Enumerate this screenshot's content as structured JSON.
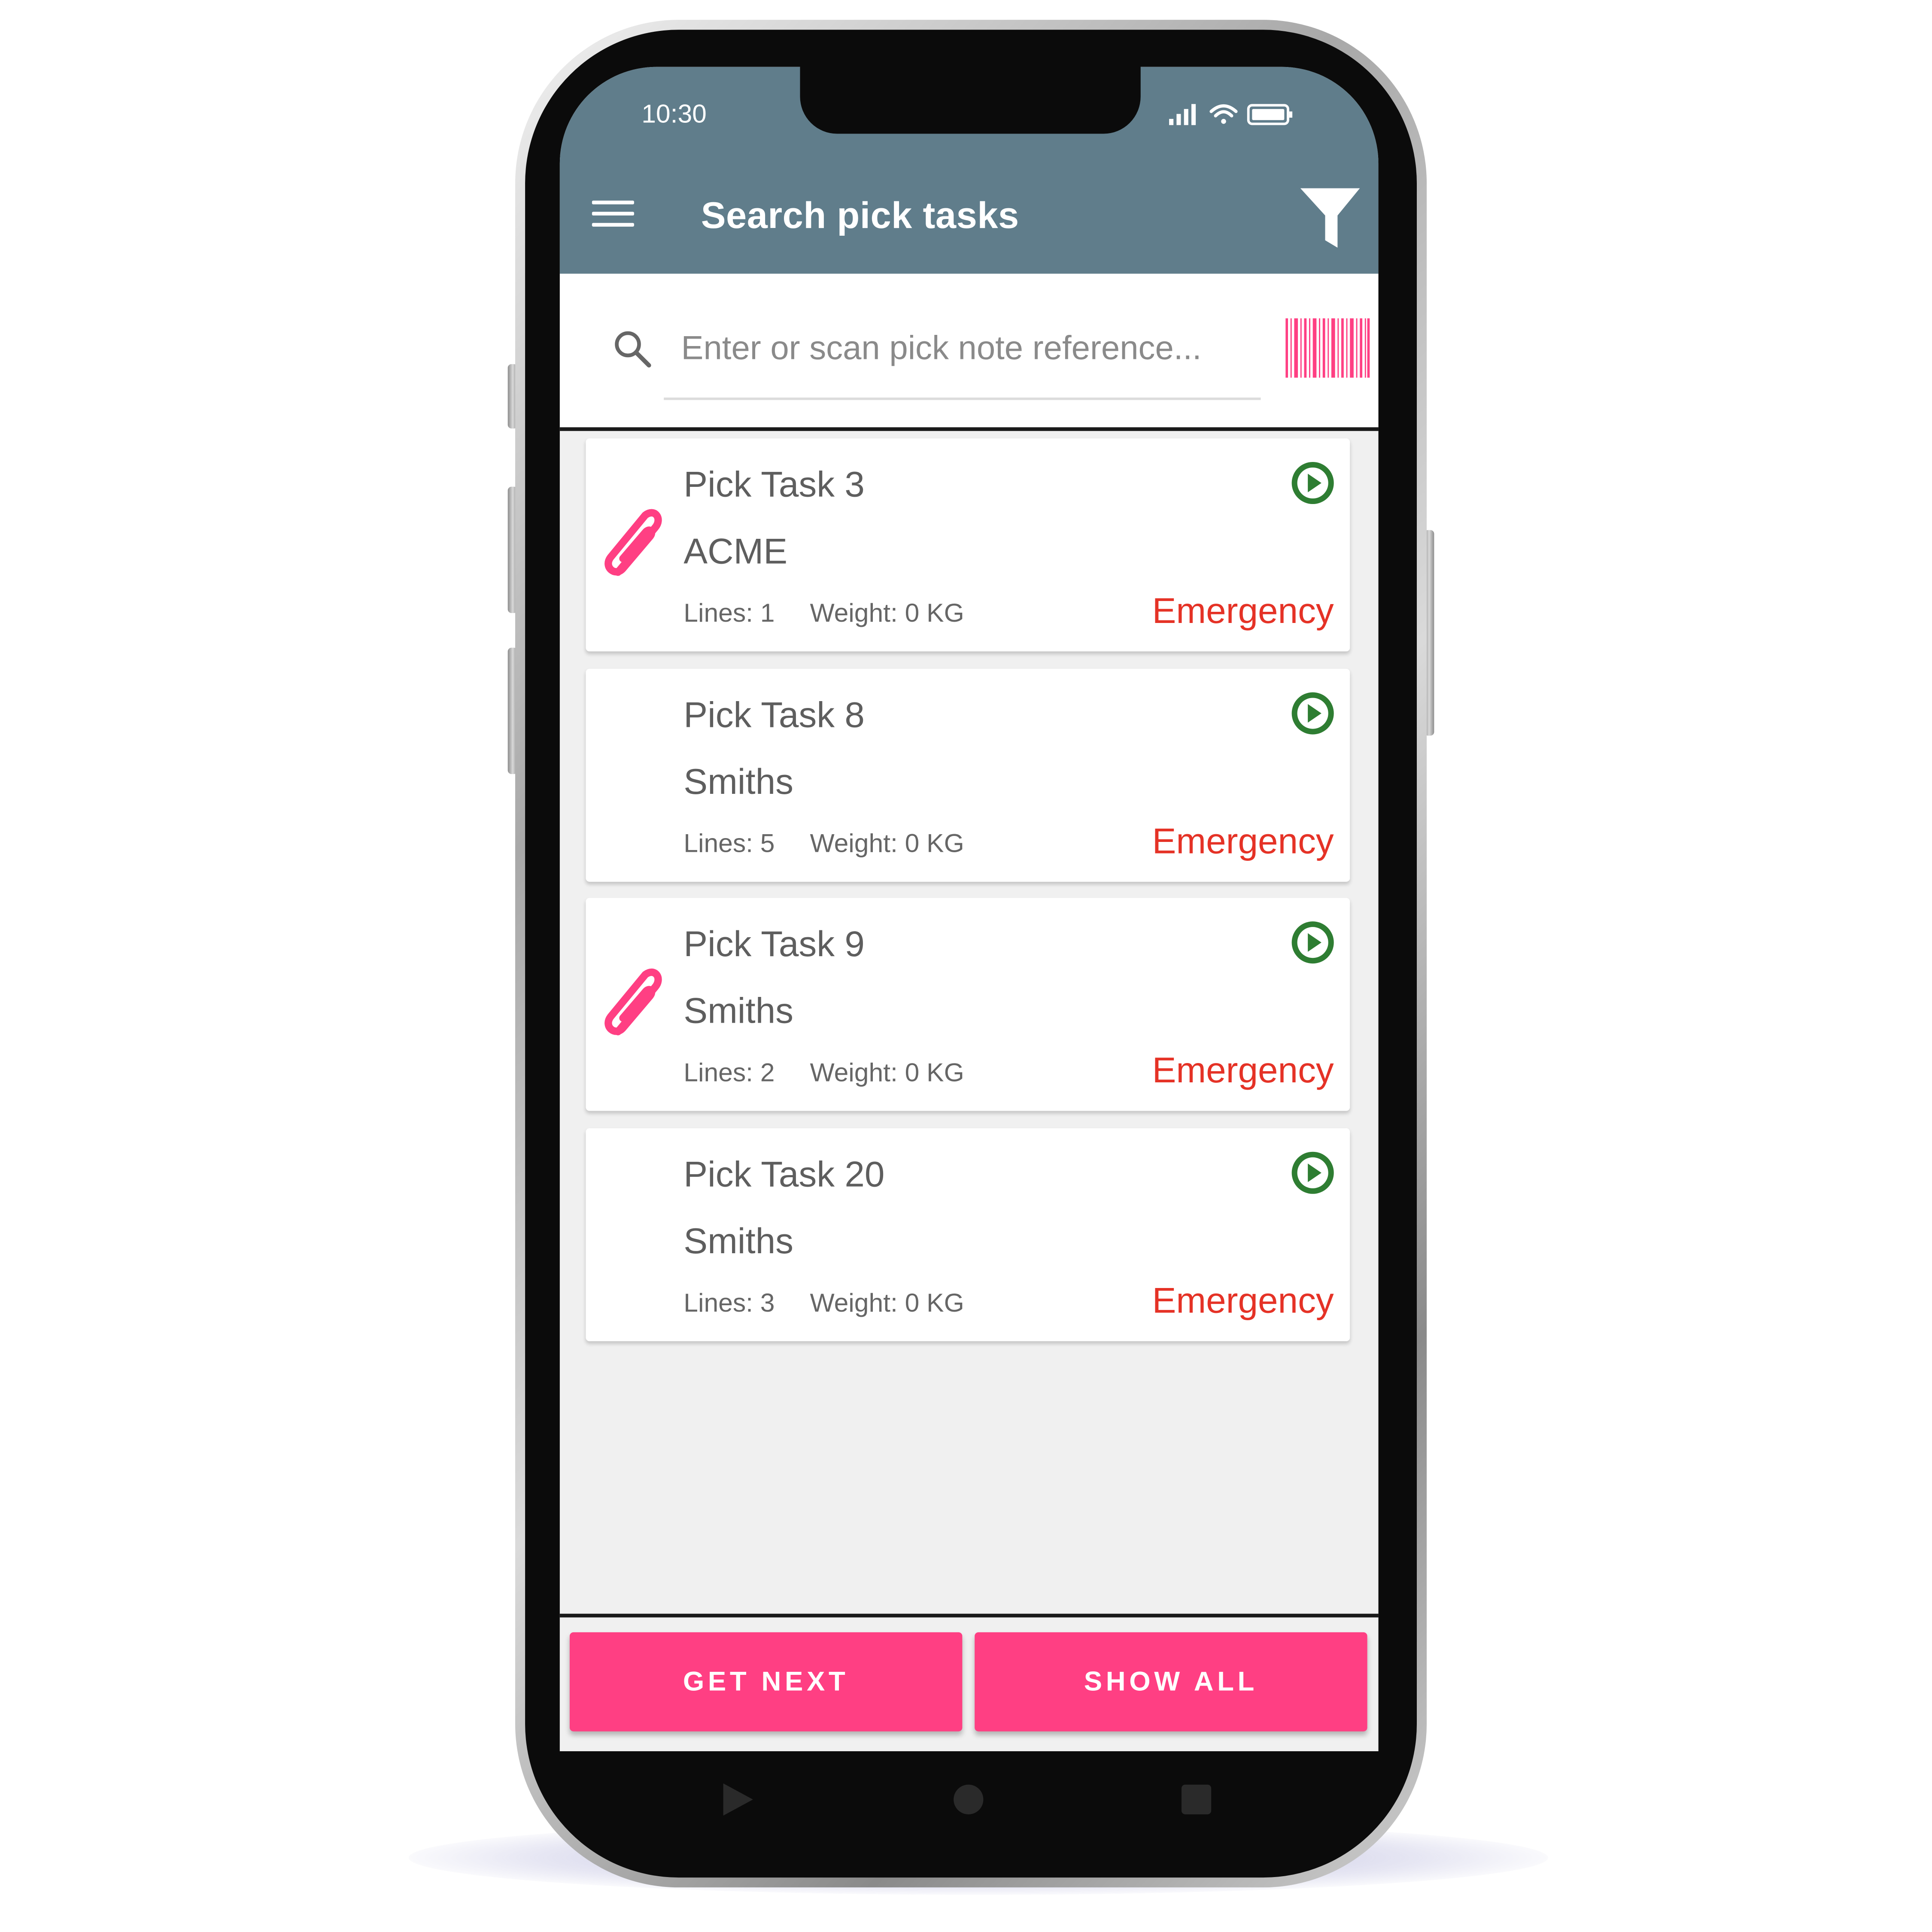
{
  "status_bar": {
    "time": "10:30"
  },
  "app_bar": {
    "title": "Search pick tasks"
  },
  "search": {
    "placeholder": "Enter or scan pick note reference..."
  },
  "tasks": [
    {
      "title": "Pick Task 3",
      "customer": "ACME",
      "lines": "Lines: 1",
      "weight": "Weight: 0 KG",
      "priority": "Emergency",
      "has_attachment": true
    },
    {
      "title": "Pick Task 8",
      "customer": "Smiths",
      "lines": "Lines: 5",
      "weight": "Weight: 0 KG",
      "priority": "Emergency",
      "has_attachment": false
    },
    {
      "title": "Pick Task 9",
      "customer": "Smiths",
      "lines": "Lines: 2",
      "weight": "Weight: 0 KG",
      "priority": "Emergency",
      "has_attachment": true
    },
    {
      "title": "Pick Task 20",
      "customer": "Smiths",
      "lines": "Lines: 3",
      "weight": "Weight: 0 KG",
      "priority": "Emergency",
      "has_attachment": false
    }
  ],
  "actions": {
    "get_next": "GET NEXT",
    "show_all": "SHOW ALL"
  },
  "colors": {
    "app_bar": "#607d8b",
    "accent": "#ff3f83",
    "priority": "#e53226",
    "play": "#2e7d32"
  },
  "icons": [
    "menu-icon",
    "filter-icon",
    "search-icon",
    "barcode-icon",
    "paperclip-icon",
    "play-icon",
    "back-icon",
    "home-icon",
    "recents-icon"
  ]
}
